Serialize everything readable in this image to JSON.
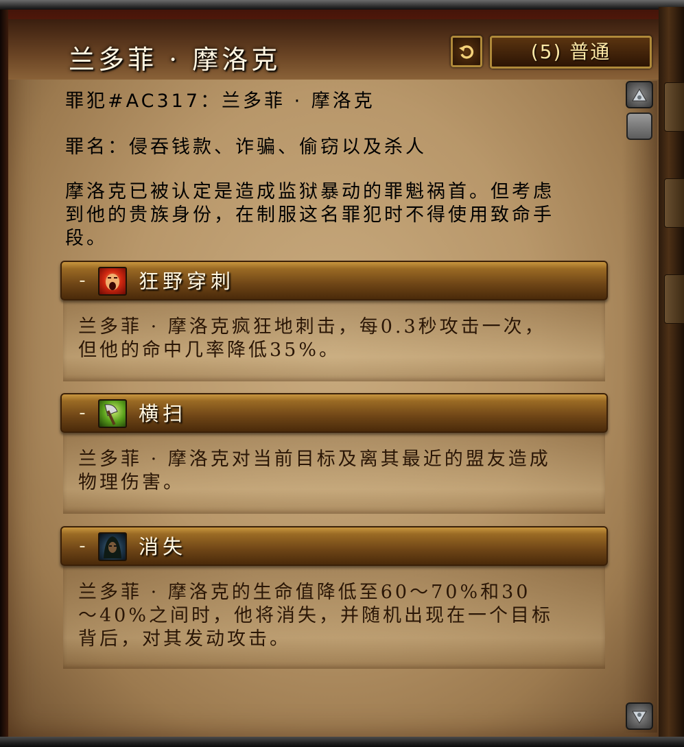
{
  "window": {
    "title": "兰多菲 · 摩洛克",
    "difficulty_label": "(5) 普通",
    "reset_icon": "reset-arrow-icon"
  },
  "overview": {
    "prisoner_id": "罪犯#AC317：兰多菲 · 摩洛克",
    "crime": "罪名：侵吞钱款、诈骗、偷窃以及杀人",
    "description_lines": [
      "摩洛克已被认定是造成监狱暴动的罪魁祸首。但考虑",
      "到他的贵族身份，在制服这名罪犯时不得使用致命手",
      "段。"
    ]
  },
  "abilities": [
    {
      "toggle": "-",
      "icon": "screaming-face-icon",
      "name": "狂野穿刺",
      "lines": [
        "兰多菲 · 摩洛克疯狂地刺击，每0.3秒攻击一次，",
        "但他的命中几率降低35%。"
      ]
    },
    {
      "toggle": "-",
      "icon": "axe-icon",
      "name": "横扫",
      "lines": [
        "兰多菲 · 摩洛克对当前目标及离其最近的盟友造成",
        "物理伤害。"
      ]
    },
    {
      "toggle": "-",
      "icon": "hooded-rogue-icon",
      "name": "消失",
      "lines": [
        "兰多菲 · 摩洛克的生命值降低至60～70%和30",
        "～40%之间时，他将消失，并随机出现在一个目标",
        "背后，对其发动攻击。"
      ]
    }
  ],
  "scrollbar": {
    "up_icon": "scroll-up-icon",
    "down_icon": "scroll-down-icon"
  }
}
